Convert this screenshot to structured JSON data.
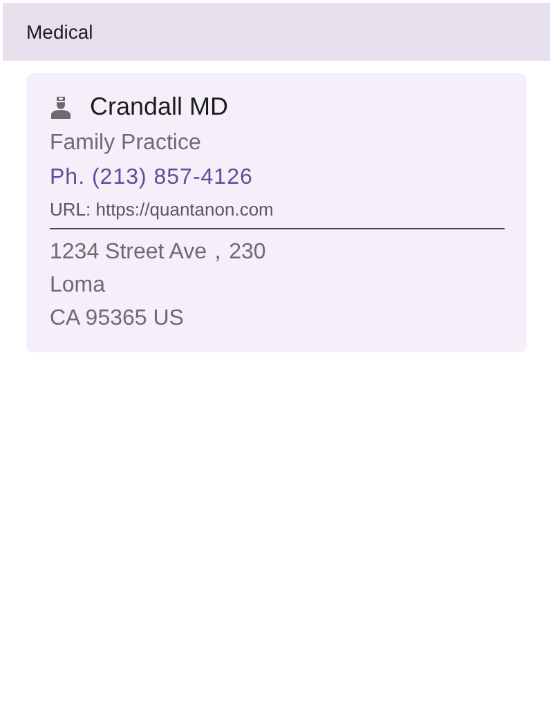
{
  "header": {
    "title": "Medical"
  },
  "card": {
    "name": "Crandall MD",
    "specialty": "Family Practice",
    "phone": "Ph. (213) 857-4126",
    "url": "URL: https://quantanon.com",
    "address": [
      "1234 Street Ave，230",
      "Loma",
      "CA 95365 US"
    ]
  }
}
